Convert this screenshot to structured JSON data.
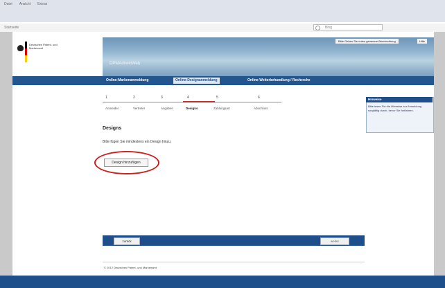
{
  "browser": {
    "menu": [
      "Datei",
      "Ansicht",
      "Extras"
    ],
    "address": "Startseite",
    "search_placeholder": "Bing"
  },
  "header": {
    "logo_text": "Deutsches Patent- und Markenamt",
    "banner_title": "DPMAdirektWeb",
    "banner_link": "Bitte Geben Sie unten genauere Beschreibung",
    "print_link": "Hilfe"
  },
  "nav": {
    "tabs": [
      "Online-Markenanmeldung",
      "Online-Designanmeldung",
      "Online-Weiterbehandlung / Recherche"
    ]
  },
  "steps": {
    "numbers": [
      "1",
      "2",
      "3",
      "4",
      "5",
      "6"
    ],
    "labels": [
      "Anmelder",
      "Vertreter",
      "Angaben",
      "Designs",
      "Zahlungsart",
      "Abschluss"
    ]
  },
  "main": {
    "title": "Designs",
    "hint": "Bitte fügen Sie mindestens ein Design hinzu.",
    "add_button": "Design hinzufügen"
  },
  "info": {
    "title": "Hinweise",
    "text": "Bitte lesen Sie die Hinweise zur Anmeldung sorgfältig durch, bevor Sie fortfahren."
  },
  "footer": {
    "back": "zurück",
    "next": "weiter",
    "copyright": "© 2012 Deutsches Patent- und Markenamt"
  },
  "colors": {
    "accent": "#1f4f8a",
    "highlight": "#cc2020"
  }
}
